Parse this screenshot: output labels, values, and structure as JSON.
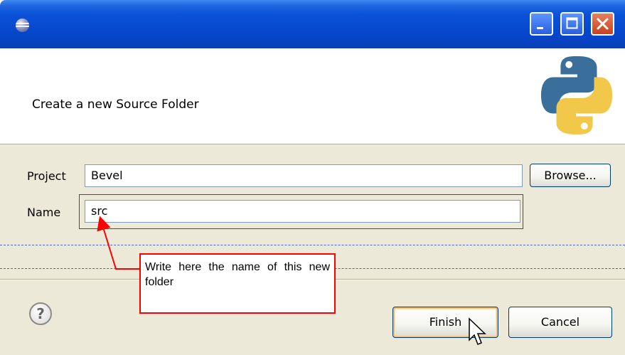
{
  "window": {
    "title": "",
    "icons": {
      "app": "eclipse-icon",
      "minimize": "minimize-icon",
      "maximize": "maximize-icon",
      "close": "close-icon"
    }
  },
  "header": {
    "message": "Create a new Source Folder",
    "logo": "python-logo"
  },
  "form": {
    "project_label": "Project",
    "project_value": "Bevel",
    "browse_label": "Browse...",
    "name_label": "Name",
    "name_value": "src"
  },
  "footer": {
    "help_icon": "help-icon",
    "help_glyph": "?",
    "finish_label": "Finish",
    "cancel_label": "Cancel"
  },
  "annotation": {
    "callout_text": "Write here the name of this new folder",
    "color": "#ff0000",
    "guide_color": "#4b68c8"
  },
  "colors": {
    "titlebar": "#0a52d9",
    "dialog_background": "#ece9d8",
    "python_blue": "#3a6f9c",
    "python_yellow": "#f2c84b"
  }
}
